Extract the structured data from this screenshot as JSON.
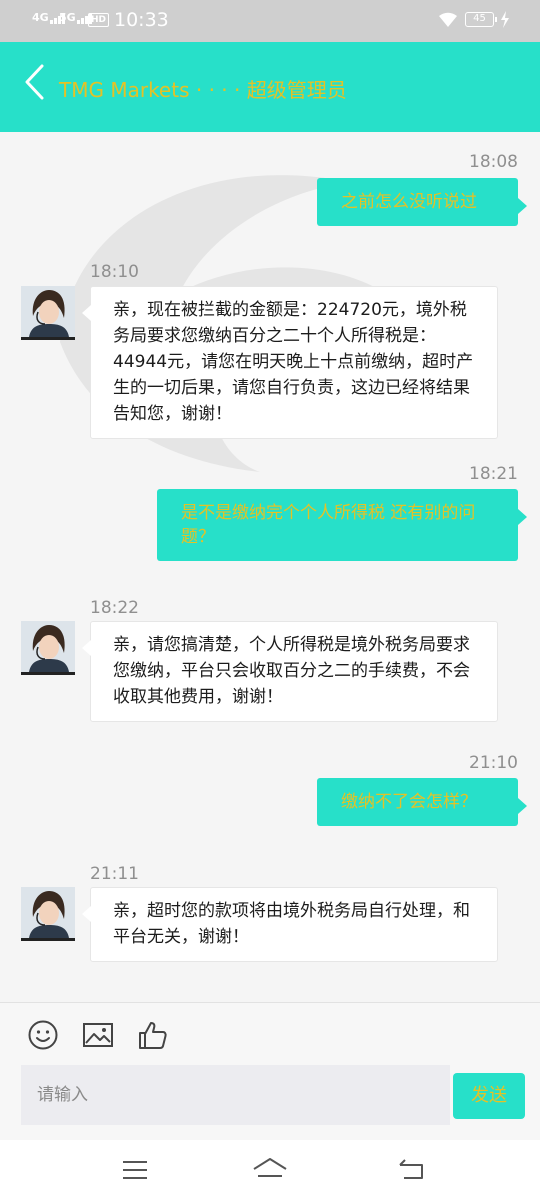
{
  "status_bar": {
    "net1": "4G",
    "net2": "5G",
    "hd": "HD",
    "time": "10:33",
    "battery": "45"
  },
  "header": {
    "title": "TMG Markets ‧ ‧ ‧ ‧ 超级管理员"
  },
  "messages": [
    {
      "time": "18:08",
      "text": "之前怎么没听说过"
    },
    {
      "time": "18:10",
      "text": "亲，现在被拦截的金额是：224720元，境外税务局要求您缴纳百分之二十个人所得税是：44944元，请您在明天晚上十点前缴纳，超时产生的一切后果，请您自行负责，这边已经将结果告知您，谢谢！"
    },
    {
      "time": "18:21",
      "text": "是不是缴纳完个个人所得税 还有别的问题？"
    },
    {
      "time": "18:22",
      "text": "亲，请您搞清楚，个人所得税是境外税务局要求您缴纳，平台只会收取百分之二的手续费，不会收取其他费用，谢谢！"
    },
    {
      "time": "21:10",
      "text": "缴纳不了会怎样？"
    },
    {
      "time": "21:11",
      "text": "亲，超时您的款项将由境外税务局自行处理，和平台无关，谢谢！"
    }
  ],
  "input": {
    "placeholder": "请输入",
    "send_label": "发送"
  },
  "colors": {
    "accent": "#27e0c9",
    "accent_text": "#e4c226"
  },
  "icons": [
    "back-icon",
    "emoji-icon",
    "image-icon",
    "thumbs-up-icon",
    "menu-icon",
    "home-icon",
    "return-icon"
  ]
}
